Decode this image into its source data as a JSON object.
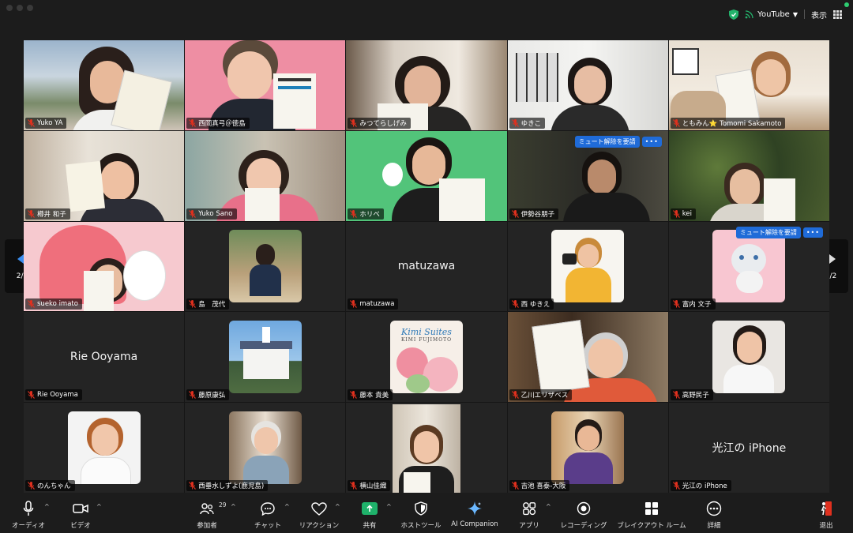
{
  "topbar": {
    "stream_label": "YouTube",
    "view_label": "表示"
  },
  "colors": {
    "accent": "#1f6bd8",
    "mic_off": "#e0301e",
    "share_green": "#1fb26b"
  },
  "tiles": [
    {
      "name": "Yuko YA",
      "muted": true
    },
    {
      "name": "西岡真弓＠徳島",
      "muted": true
    },
    {
      "name": "みつてらしげみ",
      "muted": true
    },
    {
      "name": "ゆきこ",
      "muted": true
    },
    {
      "name": "ともみん⭐ Tomomi Sakamoto",
      "muted": true
    },
    {
      "name": "樽井 和子",
      "muted": true
    },
    {
      "name": "Yuko Sano",
      "muted": true
    },
    {
      "name": "ホリベ",
      "muted": true
    },
    {
      "name": "伊勢谷朋子",
      "muted": true
    },
    {
      "name": "kei",
      "muted": true
    },
    {
      "name": "sueko imato",
      "muted": true
    },
    {
      "name": "島　茂代",
      "muted": true
    },
    {
      "name": "matuzawa",
      "muted": true,
      "big_name": "matuzawa"
    },
    {
      "name": "西 ゆきえ",
      "muted": true
    },
    {
      "name": "富内 文子",
      "muted": true
    },
    {
      "name": "Rie Ooyama",
      "muted": true,
      "big_name": "Rie Ooyama"
    },
    {
      "name": "藤原康弘",
      "muted": true
    },
    {
      "name": "藤本 貴美",
      "muted": true
    },
    {
      "name": "乙川エリザベス",
      "muted": true
    },
    {
      "name": "高野民子",
      "muted": true
    },
    {
      "name": "のんちゃん",
      "muted": true
    },
    {
      "name": "西垂水しずよ(鹿児島)",
      "muted": true
    },
    {
      "name": "横山佳織",
      "muted": true
    },
    {
      "name": "吉池 喜泰-大阪",
      "muted": true
    },
    {
      "name": "光江の iPhone",
      "muted": true,
      "big_name": "光江の iPhone"
    }
  ],
  "unmute_request": {
    "label": "ミュート解除を要請",
    "more": "•••"
  },
  "book_text": {
    "kimi_title": "Kimi Suites",
    "kimi_sub": "KIMI FUJIMOTO"
  },
  "pager": {
    "label": "2/2"
  },
  "toolbar": {
    "audio": "オーディオ",
    "video": "ビデオ",
    "participants": "参加者",
    "participants_count": "29",
    "chat": "チャット",
    "reactions": "リアクション",
    "share": "共有",
    "host_tools": "ホストツール",
    "ai_companion": "AI Companion",
    "apps": "アプリ",
    "recording": "レコーディング",
    "breakout": "ブレイクアウト ルーム",
    "more": "詳細",
    "leave": "退出"
  }
}
